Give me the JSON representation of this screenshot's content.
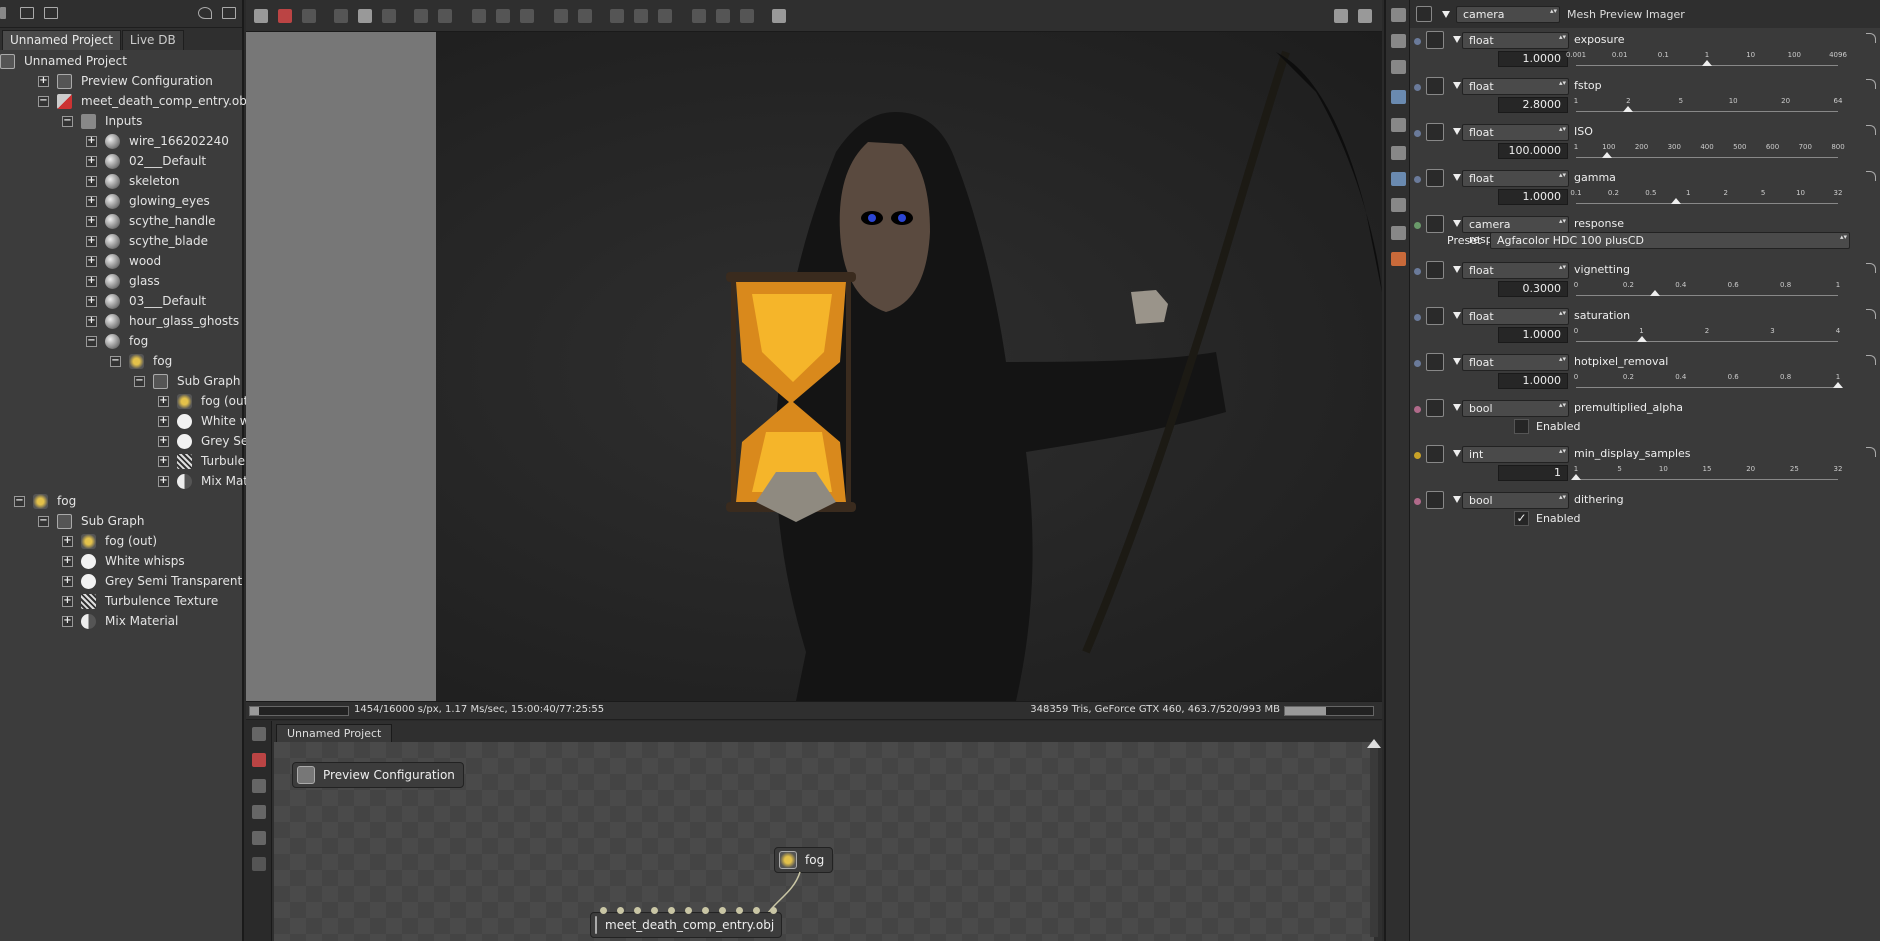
{
  "left_panel": {
    "tabs": [
      "Unnamed Project",
      "Live DB"
    ],
    "tree": [
      {
        "label": "Unnamed Project",
        "depth": 0,
        "expander": "",
        "icon": "graph-icon"
      },
      {
        "label": "Preview Configuration",
        "depth": 1,
        "expander": "+",
        "icon": "graph-icon"
      },
      {
        "label": "meet_death_comp_entry.obj",
        "depth": 1,
        "expander": "−",
        "icon": "mesh-object-icon"
      },
      {
        "label": "Inputs",
        "depth": 2,
        "expander": "−",
        "icon": "node-icon"
      },
      {
        "label": "wire_166202240",
        "depth": 3,
        "expander": "+",
        "icon": "material-sphere-icon"
      },
      {
        "label": "02___Default",
        "depth": 3,
        "expander": "+",
        "icon": "material-sphere-icon"
      },
      {
        "label": "skeleton",
        "depth": 3,
        "expander": "+",
        "icon": "material-sphere-icon"
      },
      {
        "label": "glowing_eyes",
        "depth": 3,
        "expander": "+",
        "icon": "material-sphere-icon"
      },
      {
        "label": "scythe_handle",
        "depth": 3,
        "expander": "+",
        "icon": "material-sphere-icon"
      },
      {
        "label": "scythe_blade",
        "depth": 3,
        "expander": "+",
        "icon": "material-sphere-icon"
      },
      {
        "label": "wood",
        "depth": 3,
        "expander": "+",
        "icon": "material-sphere-icon"
      },
      {
        "label": "glass",
        "depth": 3,
        "expander": "+",
        "icon": "material-sphere-icon"
      },
      {
        "label": "03___Default",
        "depth": 3,
        "expander": "+",
        "icon": "material-sphere-icon"
      },
      {
        "label": "hour_glass_ghosts",
        "depth": 3,
        "expander": "+",
        "icon": "material-sphere-icon"
      },
      {
        "label": "fog",
        "depth": 3,
        "expander": "−",
        "icon": "material-sphere-icon"
      },
      {
        "label": "fog",
        "depth": 4,
        "expander": "−",
        "icon": "fog-node-icon"
      },
      {
        "label": "Sub Graph",
        "depth": 5,
        "expander": "−",
        "icon": "graph-icon"
      },
      {
        "label": "fog (out)",
        "depth": 6,
        "expander": "+",
        "icon": "fog-node-icon"
      },
      {
        "label": "White whisps",
        "depth": 6,
        "expander": "+",
        "icon": "white-sphere-icon"
      },
      {
        "label": "Grey Semi Transparent",
        "depth": 6,
        "expander": "+",
        "icon": "white-sphere-icon"
      },
      {
        "label": "Turbulence Texture",
        "depth": 6,
        "expander": "+",
        "icon": "texture-icon"
      },
      {
        "label": "Mix Material",
        "depth": 6,
        "expander": "+",
        "icon": "mix-material-icon"
      },
      {
        "label": "fog",
        "depth": 0,
        "expander": "−",
        "icon": "fog-node-icon"
      },
      {
        "label": "Sub Graph",
        "depth": 1,
        "expander": "−",
        "icon": "graph-icon"
      },
      {
        "label": "fog (out)",
        "depth": 2,
        "expander": "+",
        "icon": "fog-node-icon"
      },
      {
        "label": "White whisps",
        "depth": 2,
        "expander": "+",
        "icon": "white-sphere-icon"
      },
      {
        "label": "Grey Semi Transparent",
        "depth": 2,
        "expander": "+",
        "icon": "white-sphere-icon"
      },
      {
        "label": "Turbulence Texture",
        "depth": 2,
        "expander": "+",
        "icon": "texture-icon"
      },
      {
        "label": "Mix Material",
        "depth": 2,
        "expander": "+",
        "icon": "mix-material-icon"
      }
    ]
  },
  "viewport": {
    "status_left": "1454/16000 s/px, 1.17 Ms/sec, 15:00:40/77:25:55",
    "status_right": "348359 Tris, GeForce GTX 460, 463.7/520/993 MB",
    "render_progress": 0.09,
    "gpu_memory_fraction": 0.47
  },
  "graph_editor": {
    "tab": "Unnamed Project",
    "nodes": {
      "preview": "Preview Configuration",
      "fog": "fog",
      "mesh": "meet_death_comp_entry.obj"
    }
  },
  "inspector": {
    "header": {
      "selector": "camera",
      "title": "Mesh Preview Imager"
    },
    "params": [
      {
        "type": "float",
        "name": "exposure",
        "value": "1.0000",
        "ticks": [
          "0.001",
          "0.01",
          "0.1",
          "1",
          "10",
          "100",
          "4096"
        ],
        "thumb": 0.5,
        "dot_color": "#6a7a9a"
      },
      {
        "type": "float",
        "name": "fstop",
        "value": "2.8000",
        "ticks": [
          "1",
          "2",
          "5",
          "10",
          "20",
          "64"
        ],
        "thumb": 0.2,
        "dot_color": "#6a7a9a"
      },
      {
        "type": "float",
        "name": "ISO",
        "value": "100.0000",
        "ticks": [
          "1",
          "100",
          "200",
          "300",
          "400",
          "500",
          "600",
          "700",
          "800"
        ],
        "thumb": 0.12,
        "dot_color": "#6a7a9a"
      },
      {
        "type": "float",
        "name": "gamma",
        "value": "1.0000",
        "ticks": [
          "0.1",
          "0.2",
          "0.5",
          "1",
          "2",
          "5",
          "10",
          "32"
        ],
        "thumb": 0.38,
        "dot_color": "#6a7a9a"
      },
      {
        "type": "camera response",
        "name": "response",
        "preset_label": "Preset",
        "preset_value": "Agfacolor HDC 100 plusCD",
        "dot_color": "#6a9a6a"
      },
      {
        "type": "float",
        "name": "vignetting",
        "value": "0.3000",
        "ticks": [
          "0",
          "0.2",
          "0.4",
          "0.6",
          "0.8",
          "1"
        ],
        "thumb": 0.3,
        "dot_color": "#6a7a9a"
      },
      {
        "type": "float",
        "name": "saturation",
        "value": "1.0000",
        "ticks": [
          "0",
          "1",
          "2",
          "3",
          "4"
        ],
        "thumb": 0.25,
        "dot_color": "#6a7a9a"
      },
      {
        "type": "float",
        "name": "hotpixel_removal",
        "value": "1.0000",
        "ticks": [
          "0",
          "0.2",
          "0.4",
          "0.6",
          "0.8",
          "1"
        ],
        "thumb": 1.0,
        "dot_color": "#6a7a9a"
      },
      {
        "type": "bool",
        "name": "premultiplied_alpha",
        "checkbox_label": "Enabled",
        "checked": false,
        "dot_color": "#b06a8a"
      },
      {
        "type": "int",
        "name": "min_display_samples",
        "value": "1",
        "ticks": [
          "1",
          "5",
          "10",
          "15",
          "20",
          "25",
          "32"
        ],
        "thumb": 0.0,
        "dot_color": "#c9a227"
      },
      {
        "type": "bool",
        "name": "dithering",
        "checkbox_label": "Enabled",
        "checked": true,
        "dot_color": "#b06a8a"
      }
    ]
  }
}
